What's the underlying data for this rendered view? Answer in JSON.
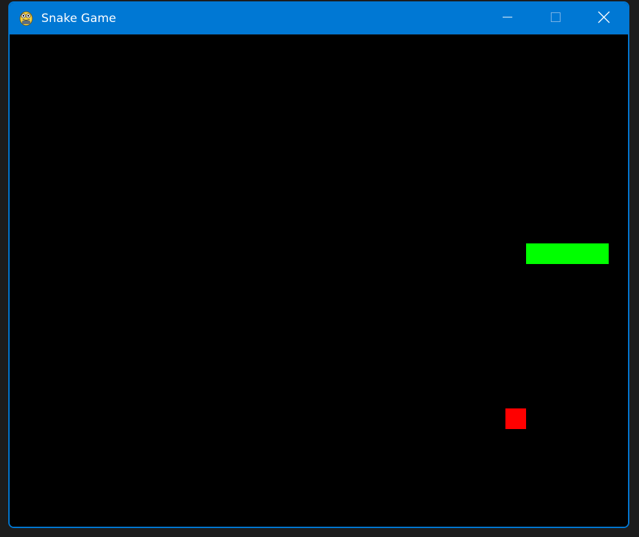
{
  "window": {
    "title": "Snake Game",
    "app_icon": "pygame-snake-icon",
    "controls": [
      "minimize-icon",
      "maximize-icon",
      "close-icon"
    ]
  },
  "game": {
    "background_color": "#000000",
    "snake_color": "#00ff00",
    "food_color": "#ff0000",
    "grid_unit": 30,
    "snake": [
      {
        "col": 25,
        "row": 10
      },
      {
        "col": 26,
        "row": 10
      },
      {
        "col": 27,
        "row": 10
      },
      {
        "col": 28,
        "row": 10
      }
    ],
    "food": {
      "col": 24,
      "row": 18
    }
  }
}
